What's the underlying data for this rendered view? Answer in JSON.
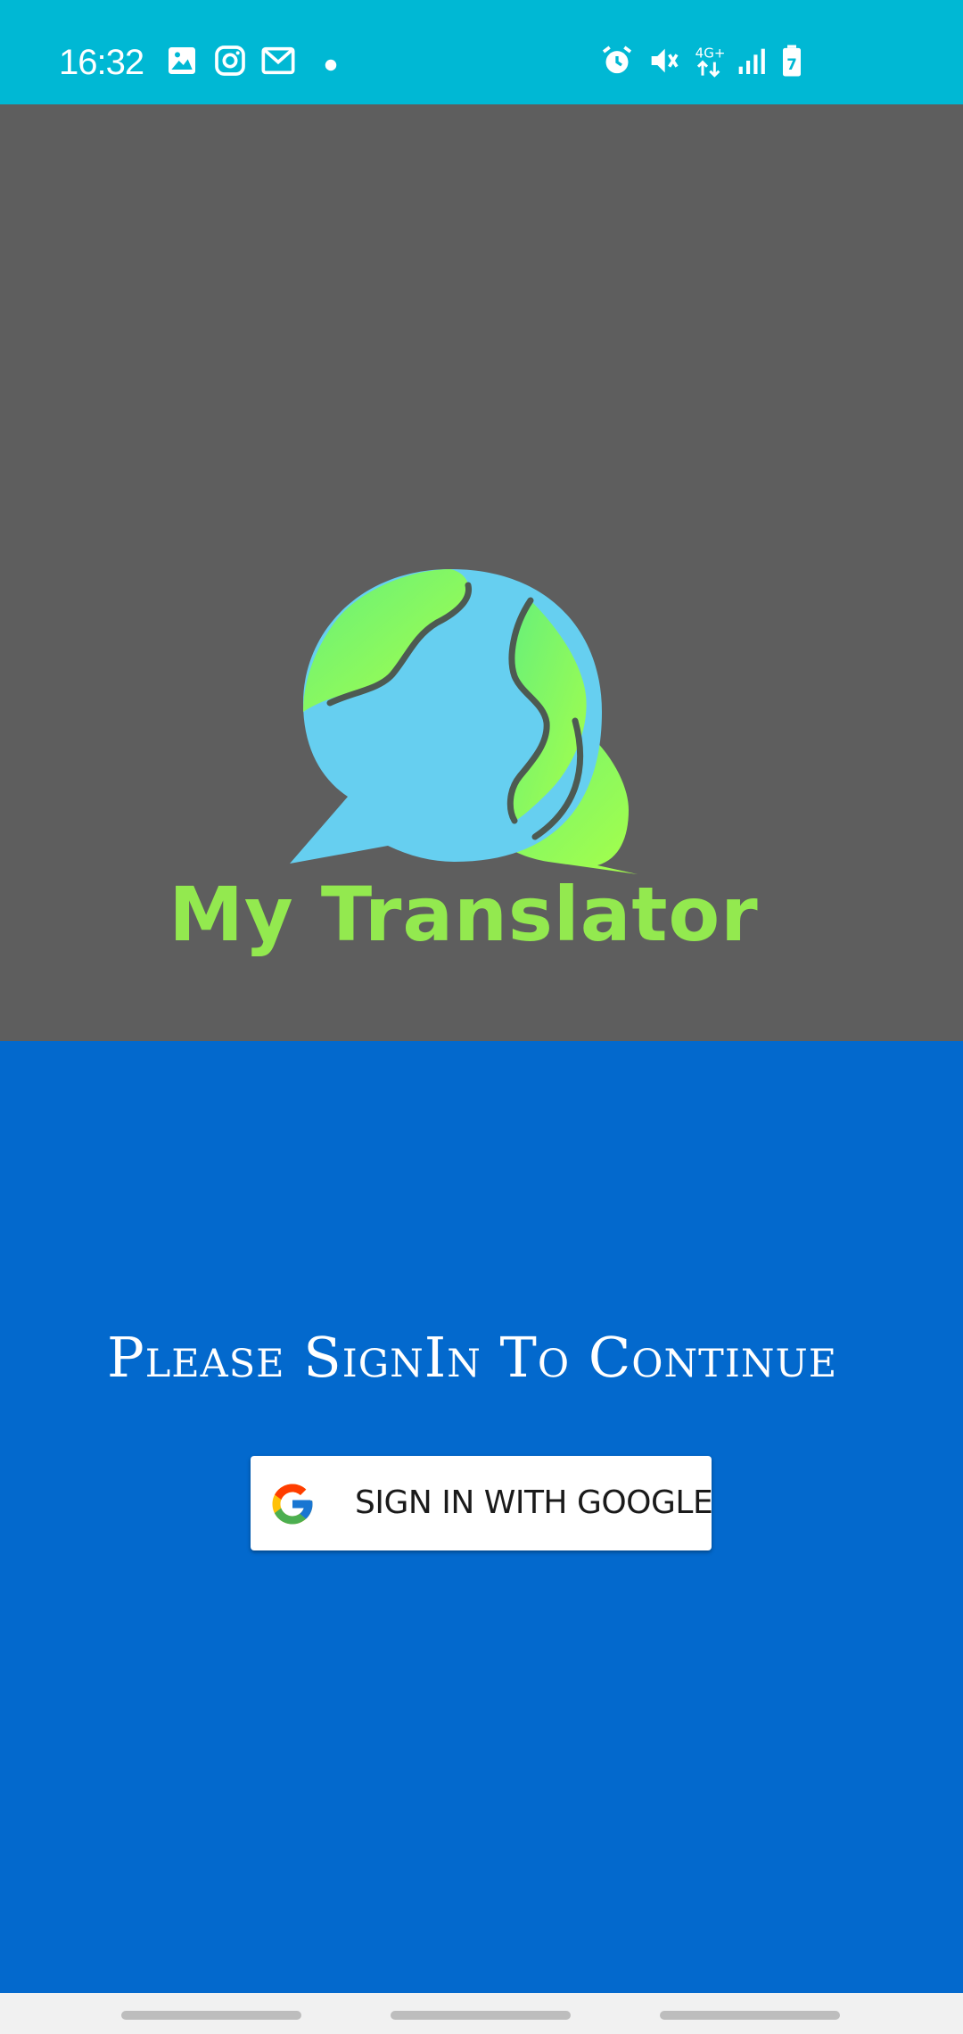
{
  "status_bar": {
    "time": "16:32",
    "background": "#00b8d4",
    "left_icons": [
      "image-icon",
      "instagram-icon",
      "gmail-icon",
      "dot-icon"
    ],
    "right_icons": [
      "alarm-icon",
      "vibrate-mute-icon",
      "network-4g-plus-icon",
      "signal-icon",
      "battery-charging-icon"
    ],
    "network_label": "4G+",
    "battery_level": "7"
  },
  "header": {
    "app_title": "My Translator",
    "background": "#5e5e5e",
    "title_color": "#93e94f"
  },
  "signin": {
    "prompt": "Please SignIn To Continue",
    "google_button_label": "SIGN IN WITH GOOGLE",
    "background": "#0369cd"
  },
  "nav_bar": {
    "background": "#f1f1f1"
  }
}
